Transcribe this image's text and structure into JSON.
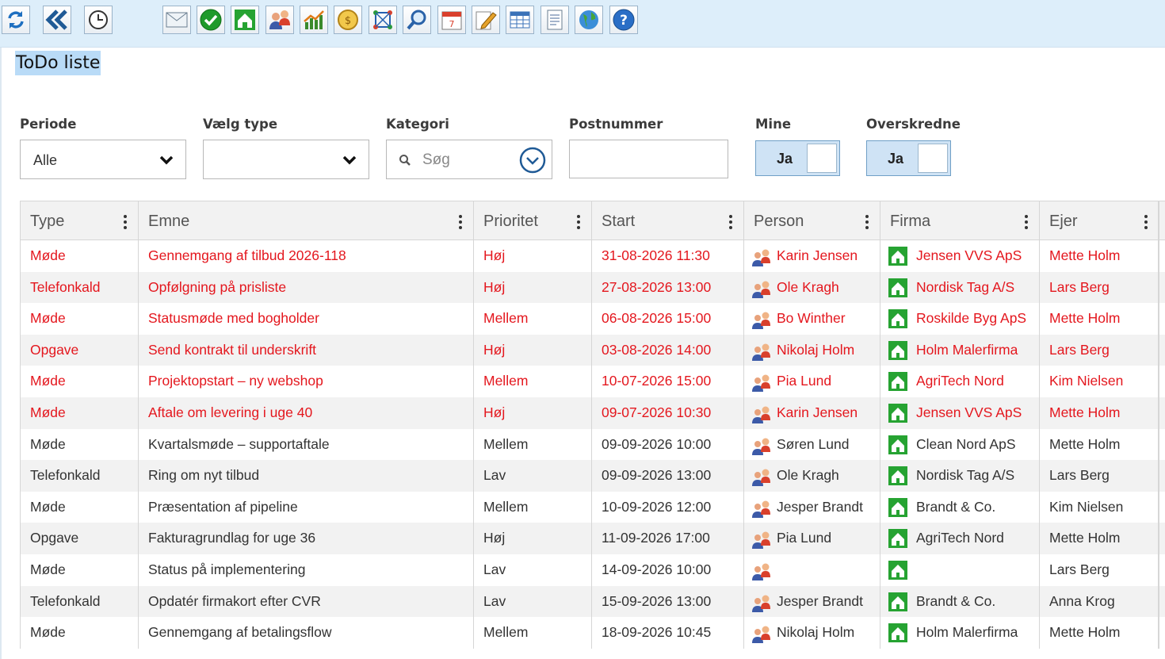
{
  "page": {
    "title": "ToDo liste"
  },
  "toolbar": {
    "buttons": [
      {
        "name": "refresh-icon"
      },
      {
        "name": "back-icon"
      },
      {
        "name": "history-clock-icon"
      },
      {
        "name": "mail-icon"
      },
      {
        "name": "approve-check-icon"
      },
      {
        "name": "company-house-icon"
      },
      {
        "name": "persons-icon"
      },
      {
        "name": "statistics-chart-icon"
      },
      {
        "name": "finance-coins-icon"
      },
      {
        "name": "network-icon"
      },
      {
        "name": "search-magnifier-icon"
      },
      {
        "name": "calendar-icon"
      },
      {
        "name": "edit-pencil-icon"
      },
      {
        "name": "table-icon"
      },
      {
        "name": "document-icon"
      },
      {
        "name": "globe-icon"
      },
      {
        "name": "help-icon"
      }
    ]
  },
  "filters": {
    "periode": {
      "label": "Periode",
      "value": "Alle"
    },
    "type": {
      "label": "Vælg type",
      "value": ""
    },
    "kategori": {
      "label": "Kategori",
      "placeholder": "Søg"
    },
    "postnummer": {
      "label": "Postnummer",
      "value": ""
    },
    "mine": {
      "label": "Mine",
      "value": "Ja"
    },
    "overskredne": {
      "label": "Overskredne",
      "value": "Ja"
    }
  },
  "grid": {
    "columns": [
      "Type",
      "Emne",
      "Prioritet",
      "Start",
      "Person",
      "Firma",
      "Ejer"
    ],
    "rows": [
      {
        "type": "Møde",
        "emne": "Gennemgang af tilbud 2026-118",
        "prioritet": "Høj",
        "start": "31-08-2026 11:30",
        "person": "Karin Jensen",
        "firma": "Jensen VVS ApS",
        "ejer": "Mette Holm",
        "overdue": true
      },
      {
        "type": "Telefonkald",
        "emne": "Opfølgning på prisliste",
        "prioritet": "Høj",
        "start": "27-08-2026 13:00",
        "person": "Ole Kragh",
        "firma": "Nordisk Tag A/S",
        "ejer": "Lars Berg",
        "overdue": true
      },
      {
        "type": "Møde",
        "emne": "Statusmøde med bogholder",
        "prioritet": "Mellem",
        "start": "06-08-2026 15:00",
        "person": "Bo Winther",
        "firma": "Roskilde Byg ApS",
        "ejer": "Mette Holm",
        "overdue": true
      },
      {
        "type": "Opgave",
        "emne": "Send kontrakt til underskrift",
        "prioritet": "Høj",
        "start": "03-08-2026 14:00",
        "person": "Nikolaj Holm",
        "firma": "Holm Malerfirma",
        "ejer": "Lars Berg",
        "overdue": true
      },
      {
        "type": "Møde",
        "emne": "Projektopstart – ny webshop",
        "prioritet": "Mellem",
        "start": "10-07-2026 15:00",
        "person": "Pia Lund",
        "firma": "AgriTech Nord",
        "ejer": "Kim Nielsen",
        "overdue": true
      },
      {
        "type": "Møde",
        "emne": "Aftale om levering i uge 40",
        "prioritet": "Høj",
        "start": "09-07-2026 10:30",
        "person": "Karin Jensen",
        "firma": "Jensen VVS ApS",
        "ejer": "Mette Holm",
        "overdue": true
      },
      {
        "type": "Møde",
        "emne": "Kvartalsmøde – supportaftale",
        "prioritet": "Mellem",
        "start": "09-09-2026 10:00",
        "person": "Søren Lund",
        "firma": "Clean Nord ApS",
        "ejer": "Mette Holm",
        "overdue": false
      },
      {
        "type": "Telefonkald",
        "emne": "Ring om nyt tilbud",
        "prioritet": "Lav",
        "start": "09-09-2026 13:00",
        "person": "Ole Kragh",
        "firma": "Nordisk Tag A/S",
        "ejer": "Lars Berg",
        "overdue": false
      },
      {
        "type": "Møde",
        "emne": "Præsentation af pipeline",
        "prioritet": "Mellem",
        "start": "10-09-2026 12:00",
        "person": "Jesper Brandt",
        "firma": "Brandt & Co.",
        "ejer": "Kim Nielsen",
        "overdue": false
      },
      {
        "type": "Opgave",
        "emne": "Fakturagrundlag for uge 36",
        "prioritet": "Høj",
        "start": "11-09-2026 17:00",
        "person": "Pia Lund",
        "firma": "AgriTech Nord",
        "ejer": "Mette Holm",
        "overdue": false
      },
      {
        "type": "Møde",
        "emne": "Status på implementering",
        "prioritet": "Lav",
        "start": "14-09-2026 10:00",
        "person": "",
        "firma": "",
        "ejer": "Lars Berg",
        "overdue": false
      },
      {
        "type": "Telefonkald",
        "emne": "Opdatér firmakort efter CVR",
        "prioritet": "Lav",
        "start": "15-09-2026 13:00",
        "person": "Jesper Brandt",
        "firma": "Brandt & Co.",
        "ejer": "Anna Krog",
        "overdue": false
      },
      {
        "type": "Møde",
        "emne": "Gennemgang af betalingsflow",
        "prioritet": "Mellem",
        "start": "18-09-2026 10:45",
        "person": "Nikolaj Holm",
        "firma": "Holm Malerfirma",
        "ejer": "Mette Holm",
        "overdue": false
      }
    ]
  },
  "colors": {
    "overdue": "#e4171e",
    "toolbar_bg": "#ddeefa",
    "accent": "#1f5a96"
  }
}
